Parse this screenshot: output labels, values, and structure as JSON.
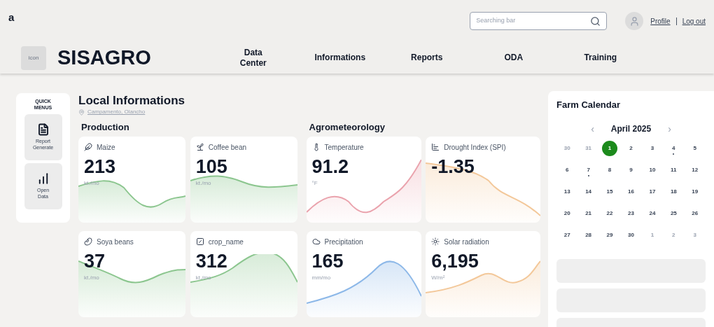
{
  "corner_mark": "a",
  "search": {
    "placeholder": "Searching bar"
  },
  "user_links": [
    "Profile",
    "Log out"
  ],
  "logo": {
    "icon_label": "icon",
    "name": "SISAGRO"
  },
  "nav": [
    {
      "label": "Data\nCenter"
    },
    {
      "label": "Informations"
    },
    {
      "label": "Reports"
    },
    {
      "label": "ODA"
    },
    {
      "label": "Training"
    }
  ],
  "quick_menus": {
    "title": "QUICK\nMENUS",
    "items": [
      {
        "label": "Report\nGenerate"
      },
      {
        "label": "Open\nData"
      }
    ]
  },
  "local": {
    "title": "Local Informations",
    "location": "Campamento, Olancho"
  },
  "sections": [
    {
      "title": "Production",
      "cards": [
        {
          "name": "Maize",
          "value": "213",
          "unit": "kt./mo",
          "color": "#8cc68f"
        },
        {
          "name": "Coffee bean",
          "value": "105",
          "unit": "kt./mo",
          "color": "#8cc68f"
        },
        {
          "name": "Soya beans",
          "value": "37",
          "unit": "kt./mo",
          "color": "#8cc68f"
        },
        {
          "name": "crop_name",
          "value": "312",
          "unit": "kt./mo",
          "color": "#8cc68f"
        }
      ]
    },
    {
      "title": "Agrometeorology",
      "cards": [
        {
          "name": "Temperature",
          "value": "91.2",
          "unit": "°F",
          "color": "#eaa3ad"
        },
        {
          "name": "Drought Index (SPI)",
          "value": "-1.35",
          "color": "#f3c89a"
        },
        {
          "name": "Precipitation",
          "value": "165",
          "unit": "mm/mo",
          "color": "#8db8e8"
        },
        {
          "name": "Solar radiation",
          "value": "6,195",
          "unit": "W/m²",
          "color": "#f3c89a"
        }
      ]
    }
  ],
  "calendar": {
    "title": "Farm Calendar",
    "month": "April 2025",
    "prev": "‹",
    "next": "›",
    "weeks": [
      [
        {
          "day": "30",
          "outside": true,
          "selected": false,
          "event": false
        },
        {
          "day": "31",
          "outside": true,
          "selected": false,
          "event": false
        },
        {
          "day": "1",
          "outside": false,
          "selected": true,
          "event": false
        },
        {
          "day": "2",
          "outside": false,
          "selected": false,
          "event": false
        },
        {
          "day": "3",
          "outside": false,
          "selected": false,
          "event": false
        },
        {
          "day": "4",
          "outside": false,
          "selected": false,
          "event": true
        },
        {
          "day": "5",
          "outside": false,
          "selected": false,
          "event": false
        }
      ],
      [
        {
          "day": "6",
          "outside": false,
          "selected": false,
          "event": false
        },
        {
          "day": "7",
          "outside": false,
          "selected": false,
          "event": true
        },
        {
          "day": "8",
          "outside": false,
          "selected": false,
          "event": false
        },
        {
          "day": "9",
          "outside": false,
          "selected": false,
          "event": false
        },
        {
          "day": "10",
          "outside": false,
          "selected": false,
          "event": false
        },
        {
          "day": "11",
          "outside": false,
          "selected": false,
          "event": false
        },
        {
          "day": "12",
          "outside": false,
          "selected": false,
          "event": false
        }
      ],
      [
        {
          "day": "13",
          "outside": false,
          "selected": false,
          "event": false
        },
        {
          "day": "14",
          "outside": false,
          "selected": false,
          "event": false
        },
        {
          "day": "15",
          "outside": false,
          "selected": false,
          "event": false
        },
        {
          "day": "16",
          "outside": false,
          "selected": false,
          "event": false
        },
        {
          "day": "17",
          "outside": false,
          "selected": false,
          "event": false
        },
        {
          "day": "18",
          "outside": false,
          "selected": false,
          "event": false
        },
        {
          "day": "19",
          "outside": false,
          "selected": false,
          "event": false
        }
      ],
      [
        {
          "day": "20",
          "outside": false,
          "selected": false,
          "event": false
        },
        {
          "day": "21",
          "outside": false,
          "selected": false,
          "event": false
        },
        {
          "day": "22",
          "outside": false,
          "selected": false,
          "event": false
        },
        {
          "day": "23",
          "outside": false,
          "selected": false,
          "event": false
        },
        {
          "day": "24",
          "outside": false,
          "selected": false,
          "event": false
        },
        {
          "day": "25",
          "outside": false,
          "selected": false,
          "event": false
        },
        {
          "day": "26",
          "outside": false,
          "selected": false,
          "event": false
        }
      ],
      [
        {
          "day": "27",
          "outside": false,
          "selected": false,
          "event": false
        },
        {
          "day": "28",
          "outside": false,
          "selected": false,
          "event": false
        },
        {
          "day": "29",
          "outside": false,
          "selected": false,
          "event": false
        },
        {
          "day": "30",
          "outside": false,
          "selected": false,
          "event": false
        },
        {
          "day": "1",
          "outside": true,
          "selected": false,
          "event": false
        },
        {
          "day": "2",
          "outside": true,
          "selected": false,
          "event": false
        },
        {
          "day": "3",
          "outside": true,
          "selected": false,
          "event": false
        }
      ]
    ]
  }
}
